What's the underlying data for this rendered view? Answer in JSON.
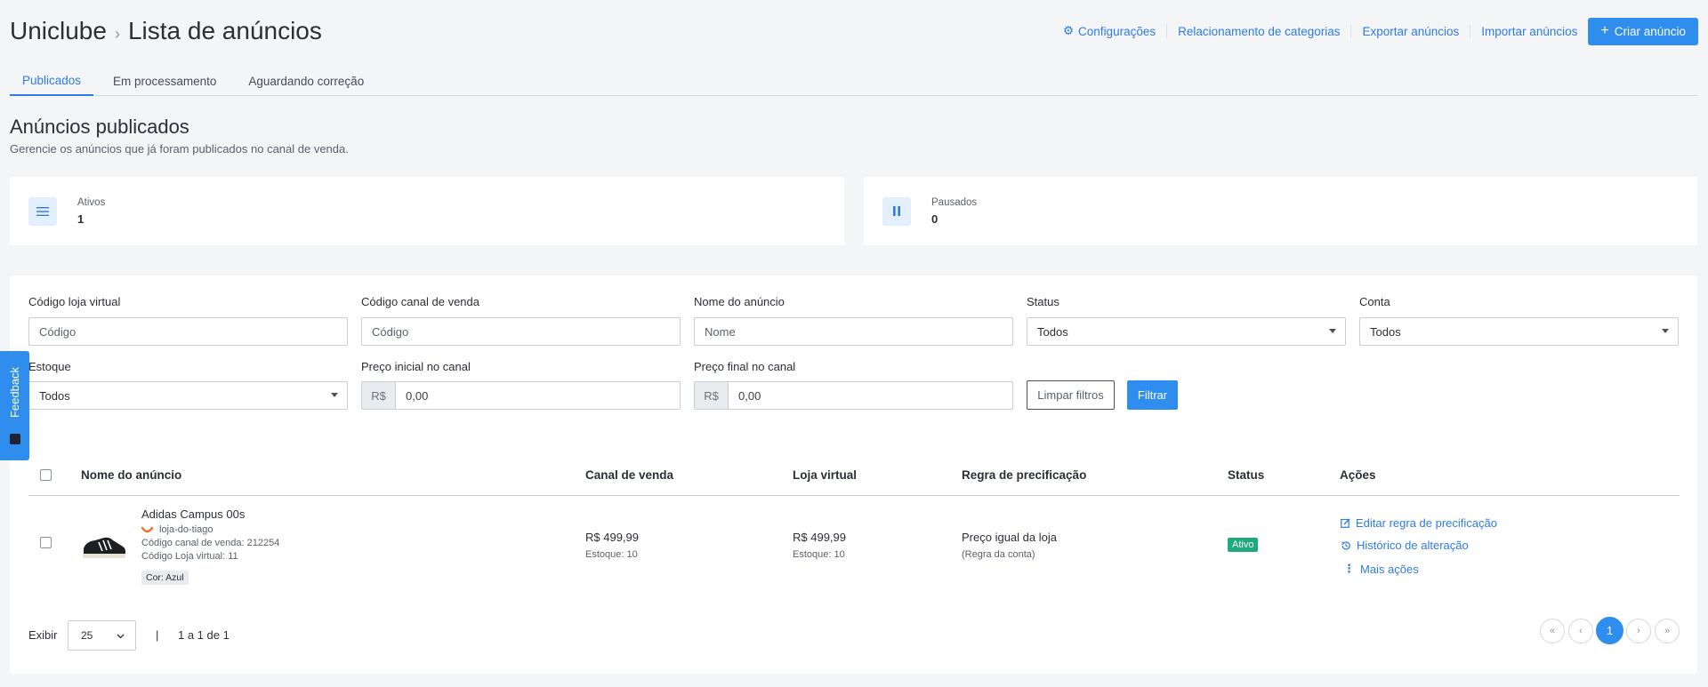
{
  "header": {
    "brand": "Uniclube",
    "separator": "›",
    "page_title": "Lista de anúncios",
    "links": {
      "settings": "Configurações",
      "category_relation": "Relacionamento de categorias",
      "export": "Exportar anúncios",
      "import": "Importar anúncios"
    },
    "create_button": "Criar anúncio"
  },
  "tabs": [
    {
      "label": "Publicados",
      "active": true
    },
    {
      "label": "Em processamento",
      "active": false
    },
    {
      "label": "Aguardando correção",
      "active": false
    }
  ],
  "section": {
    "title": "Anúncios publicados",
    "description": "Gerencie os anúncios que já foram publicados no canal de venda."
  },
  "stats": {
    "active": {
      "label": "Ativos",
      "value": "1"
    },
    "paused": {
      "label": "Pausados",
      "value": "0"
    }
  },
  "filters": {
    "store_code": {
      "label": "Código loja virtual",
      "placeholder": "Código"
    },
    "channel_code": {
      "label": "Código canal de venda",
      "placeholder": "Código"
    },
    "ad_name": {
      "label": "Nome do anúncio",
      "placeholder": "Nome"
    },
    "status": {
      "label": "Status",
      "value": "Todos"
    },
    "account": {
      "label": "Conta",
      "value": "Todos"
    },
    "stock": {
      "label": "Estoque",
      "value": "Todos"
    },
    "price_start": {
      "label": "Preço inicial no canal",
      "prefix": "R$",
      "value": "0,00"
    },
    "price_end": {
      "label": "Preço final no canal",
      "prefix": "R$",
      "value": "0,00"
    },
    "clear_button": "Limpar filtros",
    "filter_button": "Filtrar"
  },
  "table": {
    "columns": {
      "name": "Nome do anúncio",
      "channel": "Canal de venda",
      "store": "Loja virtual",
      "rule": "Regra de precificação",
      "status": "Status",
      "actions": "Ações"
    },
    "rows": [
      {
        "name": "Adidas Campus 00s",
        "store_name": "loja-do-tiago",
        "channel_code": "Código canal de venda: 212254",
        "store_code": "Código Loja virtual: 11",
        "variant": "Cor: Azul",
        "channel_price": "R$ 499,99",
        "channel_stock": "Estoque: 10",
        "store_price": "R$ 499,99",
        "store_stock": "Estoque: 10",
        "rule": "Preço igual da loja",
        "rule_note": "(Regra da conta)",
        "status": "Ativo",
        "actions": {
          "edit": "Editar regra de precificação",
          "history": "Histórico de alteração",
          "more": "Mais ações"
        }
      }
    ]
  },
  "footer": {
    "show_label": "Exibir",
    "page_size": "25",
    "separator": "|",
    "range": "1 a 1 de 1",
    "pagination": {
      "first": "«",
      "prev": "‹",
      "current": "1",
      "next": "›",
      "last": "»"
    }
  },
  "feedback": {
    "label": "Feedback"
  },
  "colors": {
    "primary": "#2f8ded",
    "link": "#2f7be0",
    "success": "#1faa7c",
    "background": "#f4f5f7"
  }
}
